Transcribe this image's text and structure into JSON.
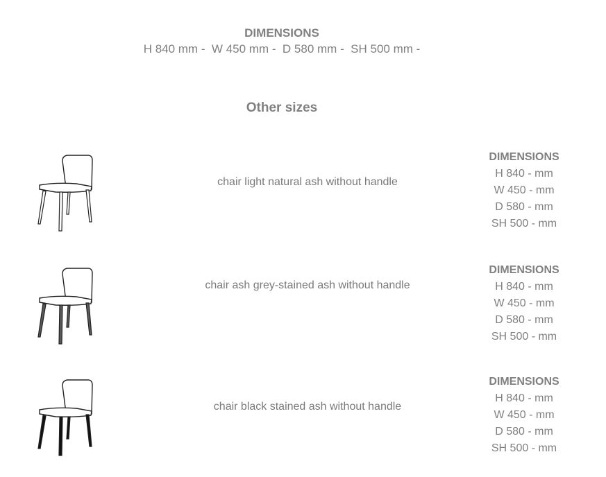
{
  "main_dimensions": {
    "heading": "DIMENSIONS",
    "line": "H 840 mm -  W 450 mm -  D 580 mm -  SH 500 mm -"
  },
  "other_sizes_title": "Other sizes",
  "variants": [
    {
      "name": "chair light natural ash without handle",
      "leg_color": "#ffffff",
      "dimensions": {
        "heading": "DIMENSIONS",
        "lines": [
          "H 840 - mm",
          "W 450 - mm",
          "D 580 - mm",
          "SH 500 - mm"
        ]
      }
    },
    {
      "name": "chair ash grey-stained ash without handle",
      "leg_color": "#5a5a5a",
      "dimensions": {
        "heading": "DIMENSIONS",
        "lines": [
          "H 840 - mm",
          "W 450 - mm",
          "D 580 - mm",
          "SH 500 - mm"
        ]
      }
    },
    {
      "name": "chair black stained ash without handle",
      "leg_color": "#111111",
      "dimensions": {
        "heading": "DIMENSIONS",
        "lines": [
          "H 840 - mm",
          "W 450 - mm",
          "D 580 - mm",
          "SH 500 - mm"
        ]
      }
    }
  ]
}
